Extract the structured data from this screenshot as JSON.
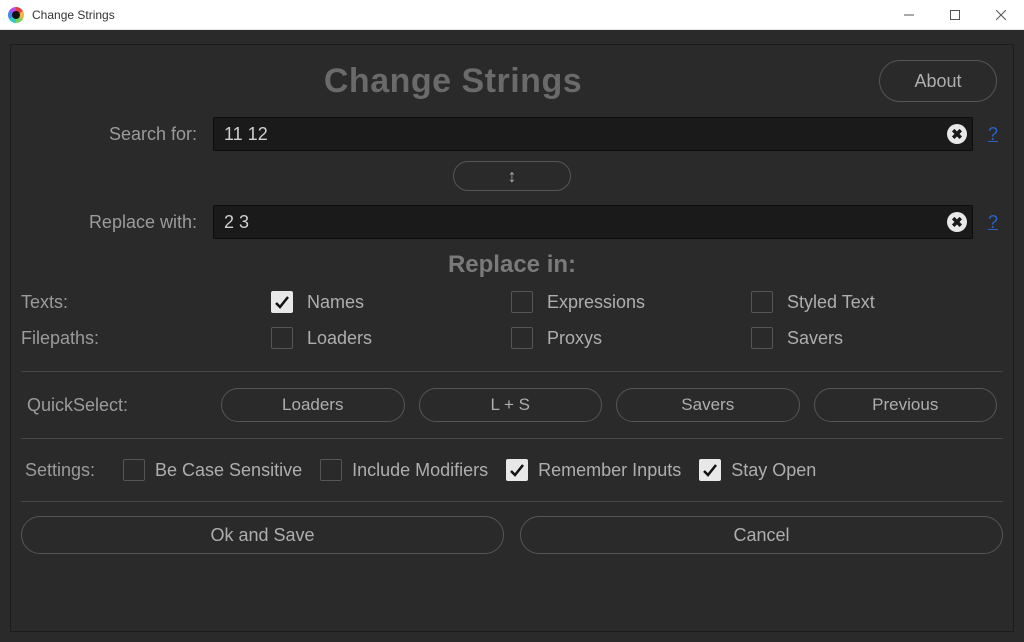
{
  "window": {
    "title": "Change Strings"
  },
  "header": {
    "title": "Change Strings",
    "about_label": "About"
  },
  "fields": {
    "search_label": "Search for:",
    "search_value": "11 12",
    "replace_label": "Replace with:",
    "replace_value": "2 3",
    "help_glyph": "?",
    "swap_glyph": "↕"
  },
  "replace_in": {
    "title": "Replace in:",
    "rows": [
      {
        "label": "Texts:",
        "items": [
          {
            "label": "Names",
            "checked": true
          },
          {
            "label": "Expressions",
            "checked": false
          },
          {
            "label": "Styled Text",
            "checked": false
          }
        ]
      },
      {
        "label": "Filepaths:",
        "items": [
          {
            "label": "Loaders",
            "checked": false
          },
          {
            "label": "Proxys",
            "checked": false
          },
          {
            "label": "Savers",
            "checked": false
          }
        ]
      }
    ]
  },
  "quickselect": {
    "label": "QuickSelect:",
    "buttons": [
      "Loaders",
      "L + S",
      "Savers",
      "Previous"
    ]
  },
  "settings": {
    "label": "Settings:",
    "items": [
      {
        "label": "Be Case Sensitive",
        "checked": false
      },
      {
        "label": "Include Modifiers",
        "checked": false
      },
      {
        "label": "Remember Inputs",
        "checked": true
      },
      {
        "label": "Stay Open",
        "checked": true
      }
    ]
  },
  "actions": {
    "ok": "Ok and Save",
    "cancel": "Cancel"
  }
}
